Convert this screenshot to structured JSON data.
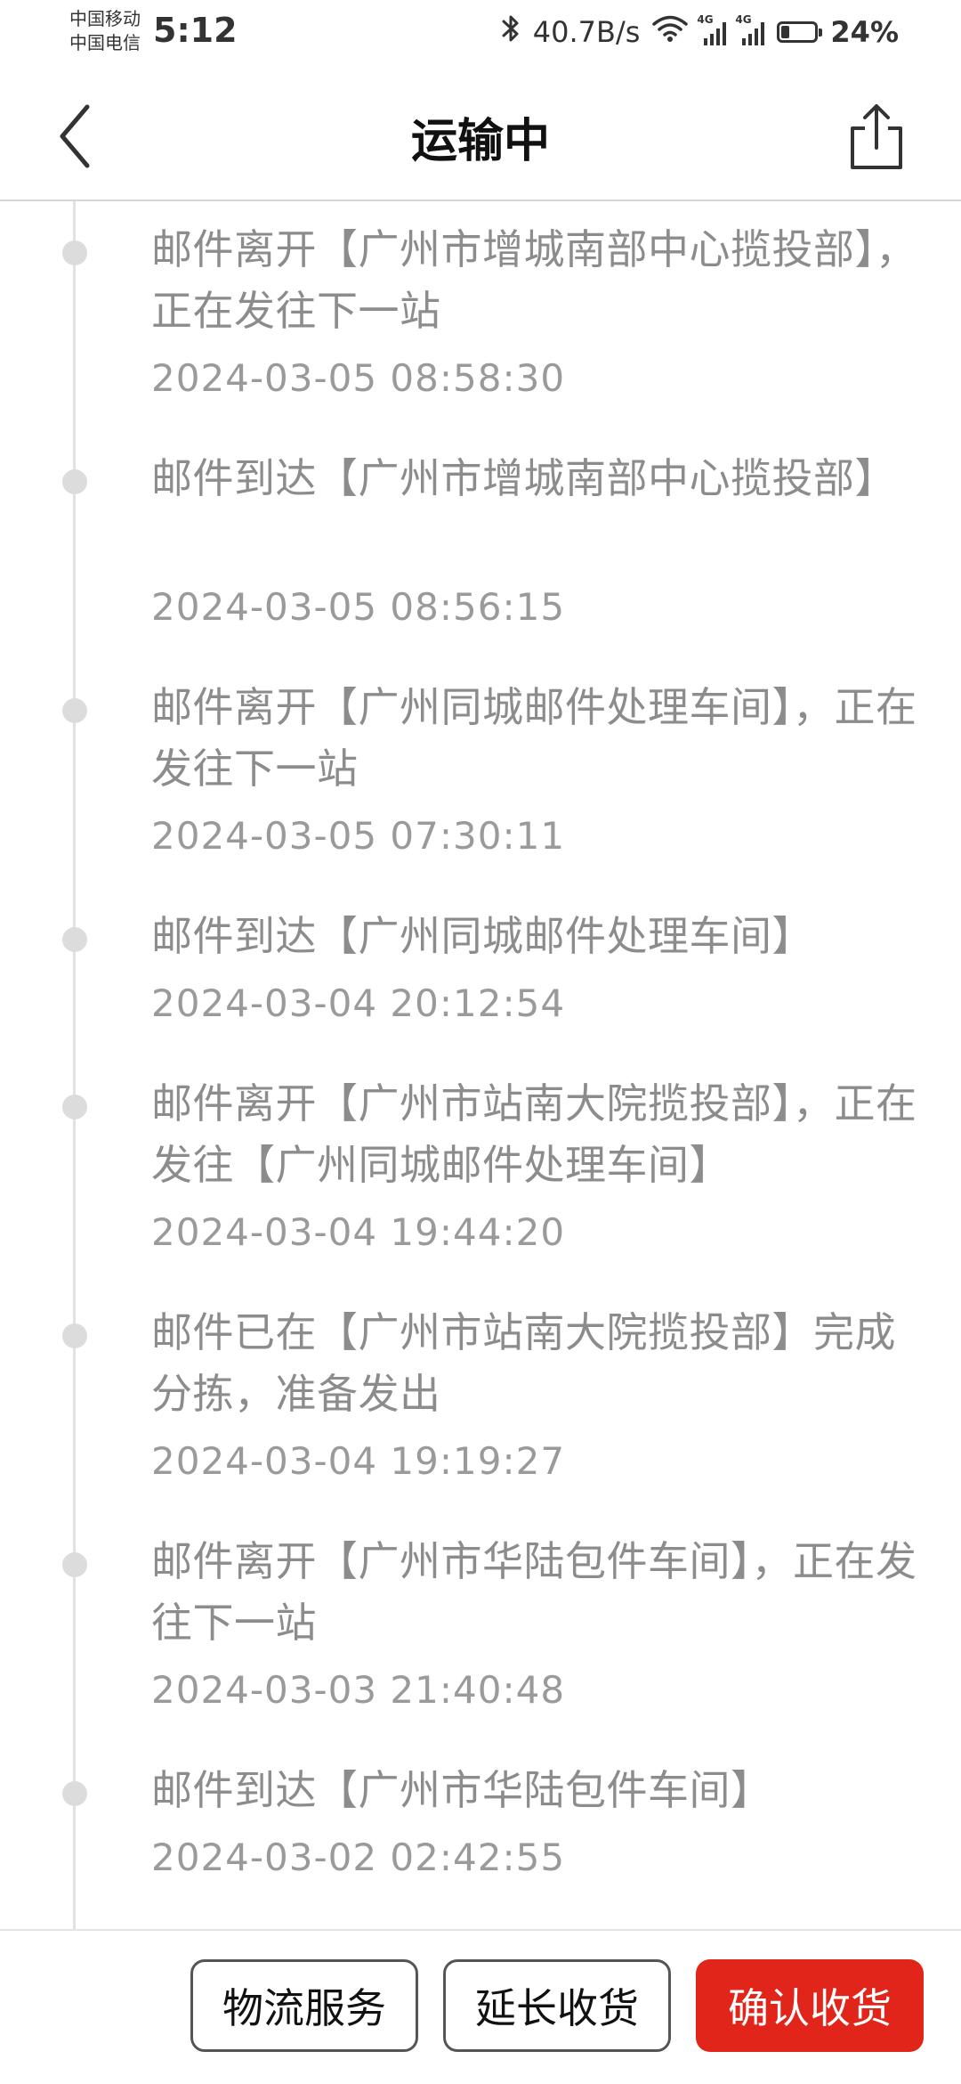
{
  "status_bar": {
    "carrier_1": "中国移动",
    "carrier_2": "中国电信",
    "time": "5:12",
    "bluetooth_icon": "bluetooth-icon",
    "network_speed": "40.7B/s",
    "wifi_icon": "wifi-icon",
    "signal_tag_1": "4G",
    "signal_tag_2": "4G",
    "battery_percent": "24%",
    "battery_level": 0.24
  },
  "nav": {
    "title": "运输中",
    "back_icon": "chevron-left-icon",
    "share_icon": "share-icon"
  },
  "timeline": {
    "events": [
      {
        "text": "邮件离开【广州市增城南部中心揽投部】，正在发往下一站",
        "time": "2024-03-05 08:58:30"
      },
      {
        "text": "邮件到达【广州市增城南部中心揽投部】",
        "time": "2024-03-05 08:56:15"
      },
      {
        "text": "邮件离开【广州同城邮件处理车间】，正在发往下一站",
        "time": "2024-03-05 07:30:11"
      },
      {
        "text": "邮件到达【广州同城邮件处理车间】",
        "time": "2024-03-04 20:12:54"
      },
      {
        "text": "邮件离开【广州市站南大院揽投部】，正在发往【广州同城邮件处理车间】",
        "time": "2024-03-04 19:44:20"
      },
      {
        "text": "邮件已在【广州市站南大院揽投部】完成分拣，准备发出",
        "time": "2024-03-04 19:19:27"
      },
      {
        "text": "邮件离开【广州市华陆包件车间】，正在发往下一站",
        "time": "2024-03-03 21:40:48"
      },
      {
        "text": "邮件到达【广州市华陆包件车间】",
        "time": "2024-03-02 02:42:55"
      }
    ]
  },
  "bottom_bar": {
    "logistics_service": "物流服务",
    "extend_receipt": "延长收货",
    "confirm_receipt": "确认收货",
    "accent_color": "#e1251b"
  }
}
